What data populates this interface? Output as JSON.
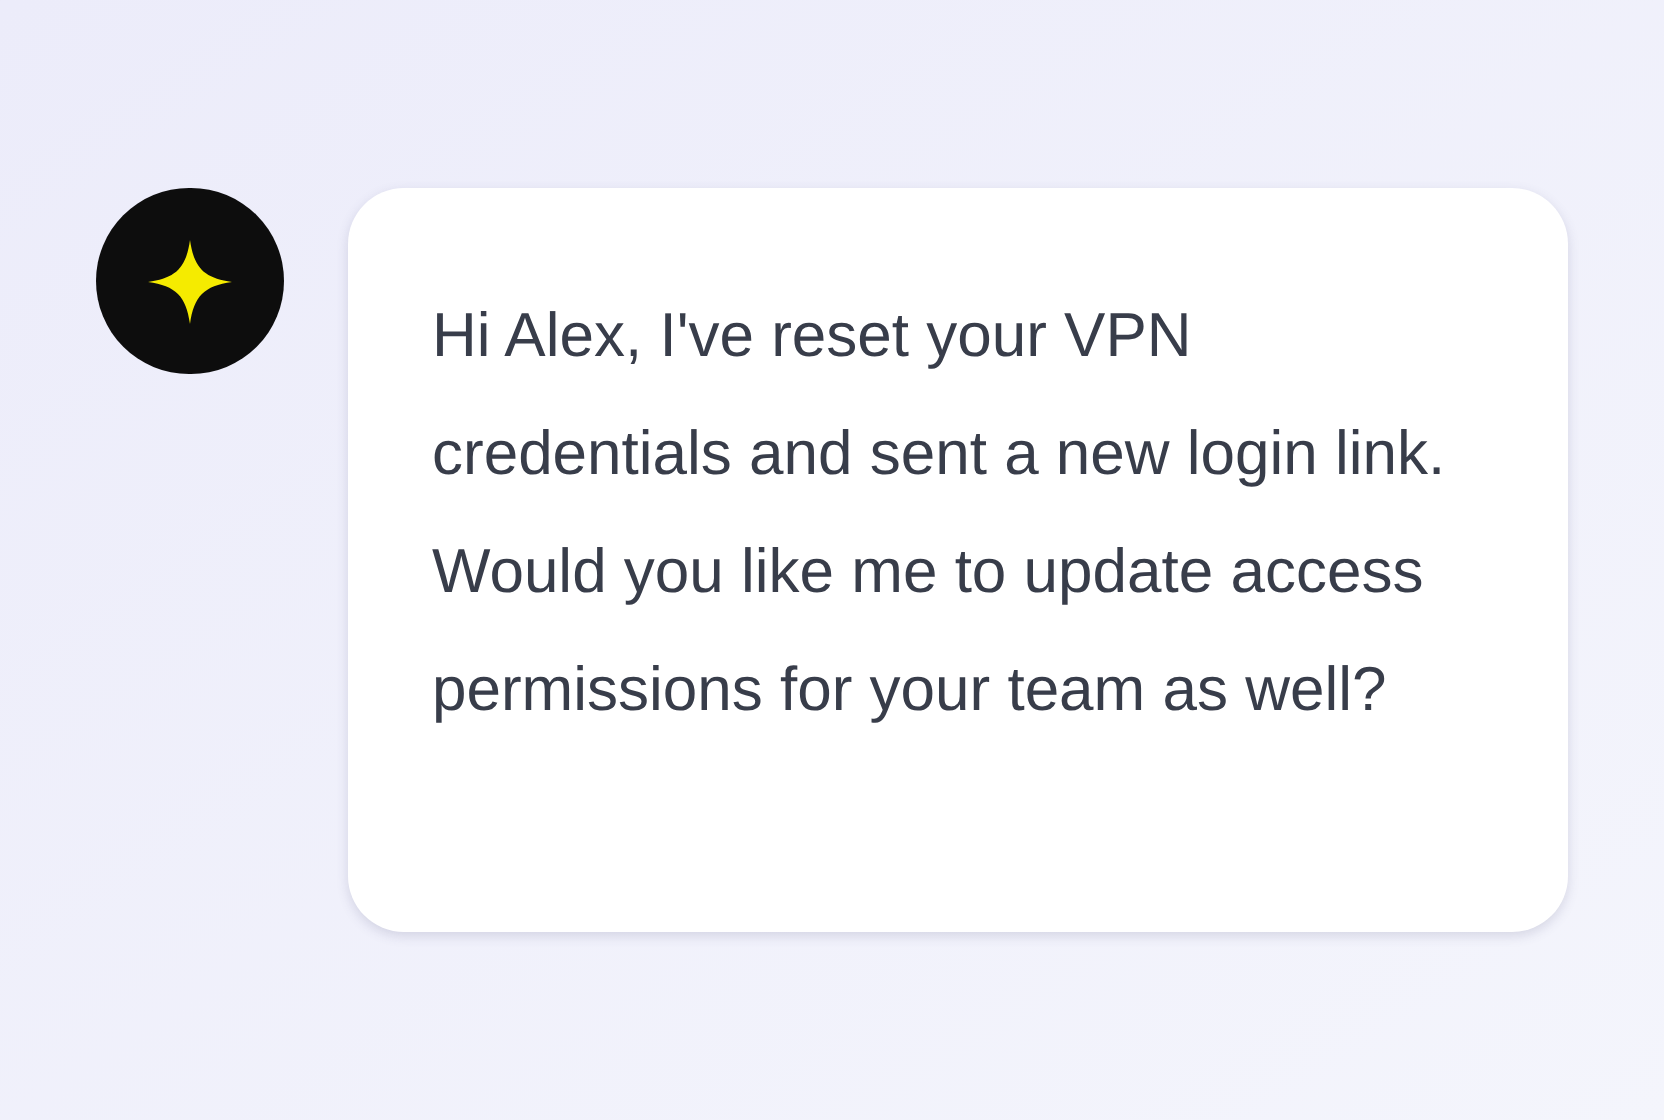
{
  "message": {
    "text": "Hi Alex, I've reset your VPN credentials and sent a new login link. Would you like me to update access permissions for your team as well?"
  }
}
